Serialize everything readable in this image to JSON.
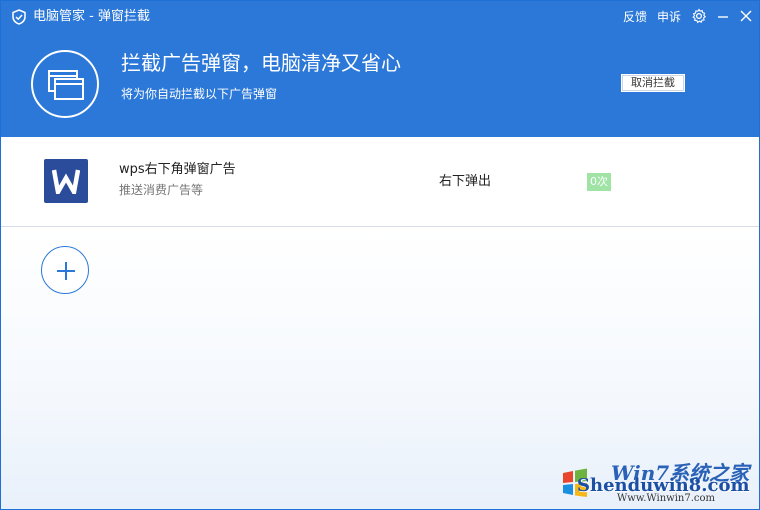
{
  "window": {
    "title": "电脑管家 - 弹窗拦截",
    "links": {
      "feedback": "反馈",
      "appeal": "申诉"
    },
    "icons": {
      "app": "shield-check-icon",
      "settings": "gear-icon",
      "minimize": "minimize-icon",
      "close": "close-icon"
    }
  },
  "banner": {
    "headline": "拦截广告弹窗，电脑清净又省心",
    "subline": "将为你自动拦截以下广告弹窗",
    "cancel_label": "取消拦截",
    "icon": "popup-window-icon"
  },
  "items": [
    {
      "name": "wps右下角弹窗广告",
      "description": "推送消费广告等",
      "position": "右下弹出",
      "count": "0次",
      "icon": "wps-logo-icon"
    }
  ],
  "add_button": {
    "icon": "plus-icon"
  },
  "watermark": {
    "top": "Win7系统之家",
    "main": "Shenduwin8.com",
    "sub": "Www.Winwin7.com"
  },
  "colors": {
    "header": "#2b78d8",
    "count_badge": "#9fe3a5",
    "wps": "#2b4c9a"
  }
}
